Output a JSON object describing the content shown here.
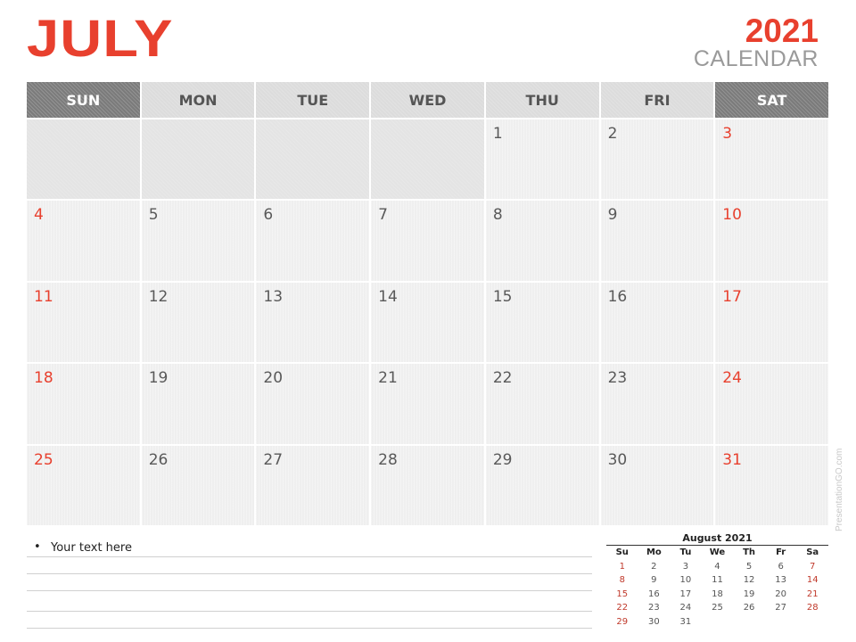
{
  "header": {
    "month": "JULY",
    "year": "2021",
    "subtitle": "CALENDAR"
  },
  "colors": {
    "accent": "#e8402e",
    "weekend_header": "#7b7b7b",
    "weekday_header": "#dcdcdc",
    "cell": "#efefef",
    "empty_cell": "#e4e4e4"
  },
  "weekdays": [
    "SUN",
    "MON",
    "TUE",
    "WED",
    "THU",
    "FRI",
    "SAT"
  ],
  "weeks": [
    [
      "",
      "",
      "",
      "",
      "1",
      "2",
      "3"
    ],
    [
      "4",
      "5",
      "6",
      "7",
      "8",
      "9",
      "10"
    ],
    [
      "11",
      "12",
      "13",
      "14",
      "15",
      "16",
      "17"
    ],
    [
      "18",
      "19",
      "20",
      "21",
      "22",
      "23",
      "24"
    ],
    [
      "25",
      "26",
      "27",
      "28",
      "29",
      "30",
      "31"
    ]
  ],
  "notes": {
    "bullet": "•",
    "text": "Your text here"
  },
  "mini_calendar": {
    "title": "August 2021",
    "weekdays": [
      "Su",
      "Mo",
      "Tu",
      "We",
      "Th",
      "Fr",
      "Sa"
    ],
    "weeks": [
      [
        "1",
        "2",
        "3",
        "4",
        "5",
        "6",
        "7"
      ],
      [
        "8",
        "9",
        "10",
        "11",
        "12",
        "13",
        "14"
      ],
      [
        "15",
        "16",
        "17",
        "18",
        "19",
        "20",
        "21"
      ],
      [
        "22",
        "23",
        "24",
        "25",
        "26",
        "27",
        "28"
      ],
      [
        "29",
        "30",
        "31",
        "",
        "",
        "",
        ""
      ]
    ]
  },
  "watermark": "PresentationGO.com"
}
